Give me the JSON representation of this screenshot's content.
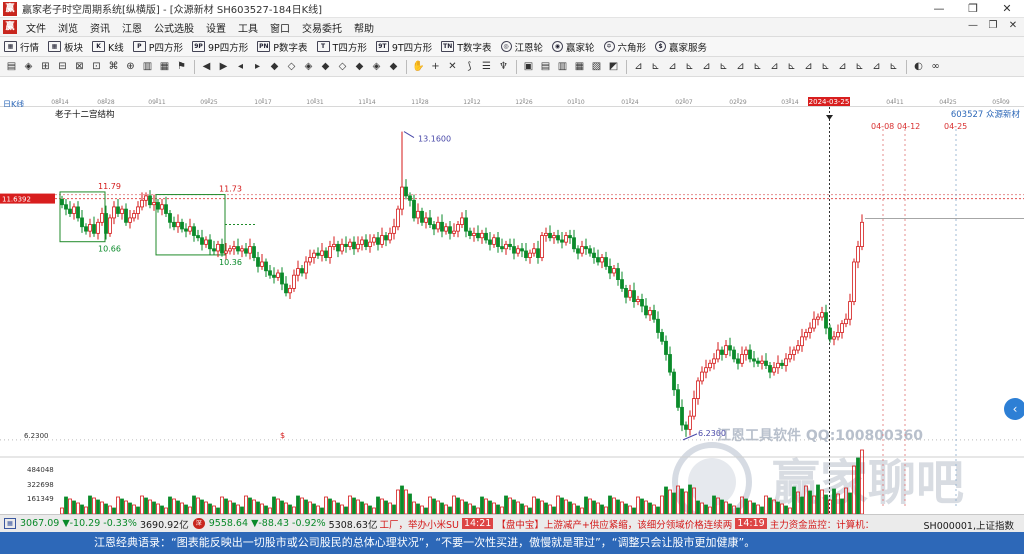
{
  "window": {
    "title": "赢家老子时空周期系统[纵横版] - [众源新材  SH603527-184日K线]",
    "controls": [
      "—",
      "❐",
      "✕"
    ],
    "mdi_controls": [
      "—",
      "❐",
      "✕"
    ]
  },
  "menu": [
    "文件",
    "浏览",
    "资讯",
    "江恩",
    "公式选股",
    "设置",
    "工具",
    "窗口",
    "交易委托",
    "帮助"
  ],
  "nav": [
    {
      "icon": "grid-icon",
      "glyph": "▦",
      "label": "行情"
    },
    {
      "icon": "blocks-icon",
      "glyph": "▦",
      "label": "板块"
    },
    {
      "icon": "kline-icon",
      "glyph": "K",
      "label": "K线"
    },
    {
      "icon": "p-square-icon",
      "glyph": "P",
      "label": "P四方形"
    },
    {
      "icon": "9p-square-icon",
      "glyph": "9P",
      "label": "9P四方形"
    },
    {
      "icon": "pn-table-icon",
      "glyph": "PN",
      "label": "P数字表"
    },
    {
      "icon": "t-square-icon",
      "glyph": "T",
      "label": "T四方形"
    },
    {
      "icon": "9t-square-icon",
      "glyph": "9T",
      "label": "9T四方形"
    },
    {
      "icon": "tn-table-icon",
      "glyph": "TN",
      "label": "T数字表"
    },
    {
      "icon": "gann-wheel-icon",
      "glyph": "◎",
      "label": "江恩轮",
      "round": true
    },
    {
      "icon": "winner-wheel-icon",
      "glyph": "◉",
      "label": "赢家轮",
      "round": true
    },
    {
      "icon": "hexagram-icon",
      "glyph": "✡",
      "label": "六角形",
      "round": true
    },
    {
      "icon": "dollar-icon",
      "glyph": "$",
      "label": "赢家服务",
      "round": true
    }
  ],
  "toolbar_groups": [
    [
      "▤",
      "◈",
      "⊞",
      "⊟",
      "⊠",
      "⊡",
      "⌘",
      "⊕",
      "▥",
      "▦",
      "⚑"
    ],
    [
      "◀",
      "▶",
      "◂",
      "▸",
      "◆",
      "◇",
      "◈",
      "◆",
      "◇",
      "◆",
      "◈",
      "◆"
    ],
    [
      "✋",
      "+",
      "✕",
      "⟆",
      "☰",
      "♆"
    ],
    [
      "▣",
      "▤",
      "▥",
      "▦",
      "▧",
      "◩"
    ],
    [
      "⊿",
      "⊾",
      "⊿",
      "⊾",
      "⊿",
      "⊾",
      "⊿",
      "⊾",
      "⊿",
      "⊾",
      "⊿",
      "⊾",
      "⊿",
      "⊾",
      "⊿",
      "⊾"
    ],
    [
      "◐",
      "∞"
    ]
  ],
  "date_axis": {
    "ticks": [
      "08-14",
      "08-28",
      "09-11",
      "09-25",
      "10-17",
      "10-31",
      "11-14",
      "11-28",
      "12-12",
      "12-26",
      "01-10",
      "01-24",
      "02-07",
      "02-29",
      "03-14",
      "03-28",
      "04-11",
      "04-25",
      "05-09"
    ],
    "cursor_date": "2024-03-25"
  },
  "chart_labels": {
    "period_label": "日K线",
    "indicator_name": "老子十二宫结构",
    "stock_code_name": "603527  众源新材",
    "price_line_value": "11.6392",
    "support_value": "6.2300",
    "dollar_mark": "$",
    "future_dates": [
      "04-08",
      "04-12",
      "04-25"
    ],
    "high_label": "13.1600",
    "low_label": "6.2300",
    "box1_high": "11.79",
    "box1_low": "10.66",
    "box2_high": "11.73",
    "box2_low": "10.36",
    "volume_ticks": [
      "484048",
      "322698",
      "161349"
    ],
    "watermark_software": "江恩工具软件  QQ:100800360",
    "watermark_brand": "赢家聊吧"
  },
  "chart_data": {
    "type": "candlestick",
    "title": "",
    "ylim": [
      6.0,
      13.4
    ],
    "high": 13.16,
    "low": 6.23,
    "current_price_line": 11.6392
  },
  "index_bar": {
    "sh_value": "3067.09",
    "sh_change": "▼-10.29",
    "sh_pct": "-0.33%",
    "sh_amount": "3690.92亿",
    "sz_value": "9558.64",
    "sz_change": "▼-88.43",
    "sz_pct": "-0.92%",
    "sz_amount": "5308.63亿",
    "ticker_prefix": "工厂，举办小米SU",
    "news_time1": "14:21",
    "news_text1": "【盘中宝】上游减产+供应紧缩，该细分领域价格连续两",
    "news_time2": "14:19",
    "news_text2": "主力资金监控：计算机：",
    "right_code": "SH000001,上证指数"
  },
  "quote": "江恩经典语录：“图表能反映出一切股市或公司股民的总体心理状况”，“不要一次性买进，傲慢就是罪过”，“调整只会让股市更加健康”。",
  "colors": {
    "up": "#d41a1a",
    "down": "#0a8a2a",
    "bar_blue": "#2d68b8",
    "cursor_red": "#d81e1e"
  }
}
